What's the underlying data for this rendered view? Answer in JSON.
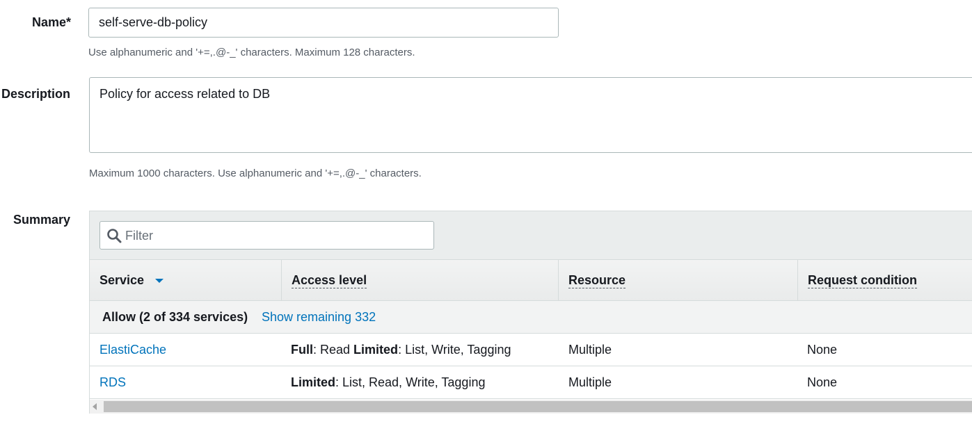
{
  "name_field": {
    "label": "Name*",
    "value": "self-serve-db-policy",
    "hint": "Use alphanumeric and '+=,.@-_' characters. Maximum 128 characters."
  },
  "description_field": {
    "label": "Description",
    "value": "Policy for access related to DB",
    "hint": "Maximum 1000 characters. Use alphanumeric and '+=,.@-_' characters."
  },
  "summary": {
    "label": "Summary",
    "filter_placeholder": "Filter",
    "columns": {
      "service": "Service",
      "access_level": "Access level",
      "resource": "Resource",
      "request_condition": "Request condition"
    },
    "allow_text": "Allow (2 of 334 services)",
    "show_remaining": "Show remaining 332",
    "rows": [
      {
        "service": "ElastiCache",
        "access_full_label": "Full",
        "access_full_value": ": Read ",
        "access_limited_label": "Limited",
        "access_limited_value": ": List, Write, Tagging",
        "resource": "Multiple",
        "request_condition": "None"
      },
      {
        "service": "RDS",
        "access_limited_label": "Limited",
        "access_limited_value": ": List, Read, Write, Tagging",
        "resource": "Multiple",
        "request_condition": "None"
      }
    ]
  },
  "colors": {
    "link": "#0073bb",
    "header_bg": "#eaeded",
    "border": "#d5dbdb"
  }
}
